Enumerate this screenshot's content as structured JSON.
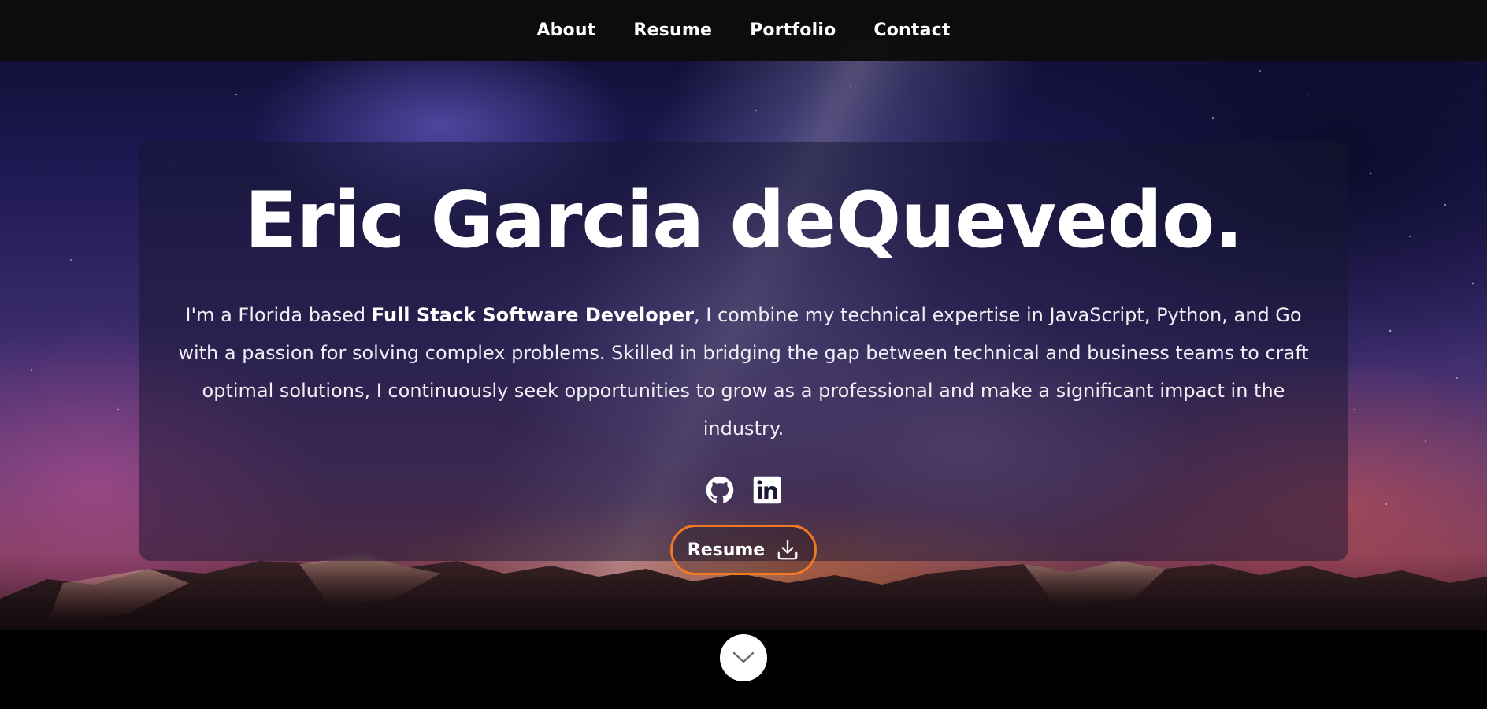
{
  "nav": {
    "items": [
      {
        "label": "About"
      },
      {
        "label": "Resume"
      },
      {
        "label": "Portfolio"
      },
      {
        "label": "Contact"
      }
    ]
  },
  "hero": {
    "title": "Eric Garcia deQuevedo.",
    "bio_prefix": "I'm a Florida based ",
    "bio_role": "Full Stack Software Developer",
    "bio_suffix": ", I combine my technical expertise in JavaScript, Python, and Go with a passion for solving complex problems. Skilled in bridging the gap between technical and business teams to craft optimal solutions, I continuously seek opportunities to grow as a professional and make a significant impact in the industry.",
    "social": [
      {
        "icon": "github-icon"
      },
      {
        "icon": "linkedin-icon"
      }
    ],
    "resume_button": {
      "label": "Resume",
      "icon": "download-icon"
    }
  },
  "scroll_down": {
    "icon": "chevron-down-icon"
  },
  "colors": {
    "accent": "#f07a22",
    "nav_bg": "#0c0c0e",
    "text": "#ffffff"
  }
}
